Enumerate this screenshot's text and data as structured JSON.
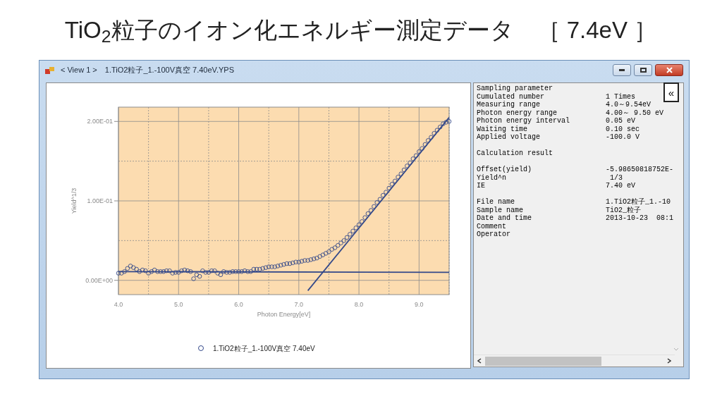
{
  "heading": "TiO$_{2}$粒子のイオン化エネルギー測定データ　［ 7.4eV ］",
  "window": {
    "title": "< View 1 >　1.TiO2粒子_1.-100V真空 7.40eV.YPS"
  },
  "chart": {
    "chart_data": {
      "type": "scatter",
      "xlabel": "Photon Energy[eV]",
      "ylabel": "Yield^1/3",
      "xlim": [
        4.0,
        9.5
      ],
      "ylim": [
        -0.018,
        0.218
      ],
      "xticks": [
        {
          "value": 4,
          "label": "4.0"
        },
        {
          "value": 5,
          "label": "5.0"
        },
        {
          "value": 6,
          "label": "6.0"
        },
        {
          "value": 7,
          "label": "7.0"
        },
        {
          "value": 8,
          "label": "8.0"
        },
        {
          "value": 9,
          "label": "9.0"
        }
      ],
      "yticks": [
        {
          "value": 0,
          "label": "0.00E+00"
        },
        {
          "value": 0.1,
          "label": "1.00E-01"
        },
        {
          "value": 0.2,
          "label": "2.00E-01"
        }
      ],
      "x": [
        4.0,
        4.05,
        4.1,
        4.15,
        4.2,
        4.25,
        4.3,
        4.35,
        4.4,
        4.45,
        4.5,
        4.55,
        4.6,
        4.65,
        4.7,
        4.75,
        4.8,
        4.85,
        4.9,
        4.95,
        5.0,
        5.05,
        5.1,
        5.15,
        5.2,
        5.25,
        5.3,
        5.35,
        5.4,
        5.45,
        5.5,
        5.55,
        5.6,
        5.65,
        5.7,
        5.75,
        5.8,
        5.85,
        5.9,
        5.95,
        6.0,
        6.05,
        6.1,
        6.15,
        6.2,
        6.25,
        6.3,
        6.35,
        6.4,
        6.45,
        6.5,
        6.55,
        6.6,
        6.65,
        6.7,
        6.75,
        6.8,
        6.85,
        6.9,
        6.95,
        7.0,
        7.05,
        7.1,
        7.15,
        7.2,
        7.25,
        7.3,
        7.35,
        7.4,
        7.45,
        7.5,
        7.55,
        7.6,
        7.65,
        7.7,
        7.75,
        7.8,
        7.85,
        7.9,
        7.95,
        8.0,
        8.05,
        8.1,
        8.15,
        8.2,
        8.25,
        8.3,
        8.35,
        8.4,
        8.45,
        8.5,
        8.55,
        8.6,
        8.65,
        8.7,
        8.75,
        8.8,
        8.85,
        8.9,
        8.95,
        9.0,
        9.05,
        9.1,
        9.15,
        9.2,
        9.25,
        9.3,
        9.35,
        9.4,
        9.45,
        9.5
      ],
      "series": [
        {
          "name": "1.TiO2粒子_1.-100V真空 7.40eV",
          "color": "#34498a",
          "values": [
            0.009,
            0.009,
            0.011,
            0.015,
            0.018,
            0.016,
            0.014,
            0.011,
            0.013,
            0.012,
            0.009,
            0.011,
            0.013,
            0.011,
            0.011,
            0.011,
            0.012,
            0.012,
            0.009,
            0.01,
            0.01,
            0.012,
            0.013,
            0.012,
            0.011,
            0.002,
            0.007,
            0.005,
            0.012,
            0.01,
            0.01,
            0.012,
            0.012,
            0.009,
            0.007,
            0.011,
            0.01,
            0.01,
            0.011,
            0.011,
            0.011,
            0.011,
            0.012,
            0.011,
            0.011,
            0.014,
            0.014,
            0.014,
            0.015,
            0.016,
            0.017,
            0.017,
            0.017,
            0.018,
            0.019,
            0.02,
            0.021,
            0.021,
            0.022,
            0.023,
            0.023,
            0.024,
            0.025,
            0.025,
            0.026,
            0.027,
            0.028,
            0.03,
            0.032,
            0.034,
            0.036,
            0.039,
            0.041,
            0.044,
            0.047,
            0.05,
            0.054,
            0.058,
            0.062,
            0.066,
            0.07,
            0.074,
            0.079,
            0.084,
            0.088,
            0.093,
            0.098,
            0.102,
            0.107,
            0.111,
            0.116,
            0.121,
            0.125,
            0.13,
            0.134,
            0.139,
            0.144,
            0.148,
            0.153,
            0.157,
            0.162,
            0.166,
            0.171,
            0.176,
            0.18,
            0.185,
            0.189,
            0.193,
            0.197,
            0.199,
            0.2
          ]
        },
        {
          "type": "line",
          "color": "#34498a",
          "values": [
            0.011,
            null,
            null,
            null,
            null,
            null,
            null,
            null,
            null,
            null,
            null,
            null,
            null,
            null,
            null,
            null,
            null,
            null,
            null,
            null,
            null,
            null,
            null,
            null,
            null,
            null,
            null,
            null,
            null,
            null,
            null,
            null,
            null,
            null,
            null,
            null,
            null,
            null,
            null,
            null,
            null,
            null,
            null,
            null,
            null,
            null,
            null,
            null,
            null,
            null,
            null,
            null,
            null,
            null,
            null,
            null,
            null,
            null,
            null,
            null,
            null,
            null,
            null,
            null,
            null,
            null,
            null,
            null,
            null,
            null,
            null,
            null,
            null,
            null,
            null,
            null,
            null,
            null,
            null,
            null,
            null,
            null,
            null,
            null,
            null,
            null,
            null,
            null,
            null,
            null,
            null,
            null,
            null,
            null,
            null,
            null,
            null,
            null,
            null,
            null,
            null,
            null,
            null,
            null,
            null,
            null,
            null,
            null,
            null,
            null,
            0.01
          ]
        },
        {
          "type": "line",
          "color": "#34498a",
          "values": [
            null,
            null,
            null,
            null,
            null,
            null,
            null,
            null,
            null,
            null,
            null,
            null,
            null,
            null,
            null,
            null,
            null,
            null,
            null,
            null,
            null,
            null,
            null,
            null,
            null,
            null,
            null,
            null,
            null,
            null,
            null,
            null,
            null,
            null,
            null,
            null,
            null,
            null,
            null,
            null,
            null,
            null,
            null,
            null,
            null,
            null,
            null,
            null,
            null,
            null,
            null,
            null,
            null,
            null,
            null,
            null,
            null,
            null,
            null,
            null,
            null,
            null,
            null,
            -0.013,
            null,
            null,
            null,
            null,
            null,
            null,
            null,
            null,
            null,
            null,
            null,
            null,
            null,
            null,
            null,
            null,
            null,
            null,
            null,
            null,
            null,
            null,
            null,
            null,
            null,
            null,
            null,
            null,
            null,
            null,
            null,
            null,
            null,
            null,
            null,
            null,
            null,
            null,
            null,
            null,
            null,
            null,
            null,
            null,
            null,
            null,
            0.205
          ]
        }
      ],
      "grid": true
    }
  },
  "info": {
    "sections": [
      {
        "heading": "Sampling parameter",
        "rows": [
          {
            "label": "Cumulated number",
            "value": "1 Times"
          },
          {
            "label": "Measuring range",
            "value": "4.0～9.54eV"
          },
          {
            "label": "Photon energy range",
            "value": "4.00～ 9.50 eV"
          },
          {
            "label": "Photon energy interval",
            "value": "0.05 eV"
          },
          {
            "label": "Waiting time",
            "value": "0.10 sec"
          },
          {
            "label": "Applied voltage",
            "value": "-100.0 V"
          }
        ]
      },
      {
        "heading": "Calculation result"
      },
      {
        "rows": [
          {
            "label": "Offset(yield)",
            "value": "-5.98650818752E-"
          },
          {
            "label": "Yield^n",
            "value": " 1/3"
          },
          {
            "label": "IE",
            "value": "7.40 eV"
          }
        ]
      },
      {
        "rows": [
          {
            "label": "File name",
            "value": "1.TiO2粒子_1.-10"
          },
          {
            "label": "Sample name",
            "value": "TiO2_粒子"
          },
          {
            "label": "Date and time",
            "value": "2013-10-23  08:1"
          },
          {
            "label": "Comment"
          },
          {
            "label": "Operator"
          }
        ]
      }
    ],
    "collapse_button": "«"
  }
}
